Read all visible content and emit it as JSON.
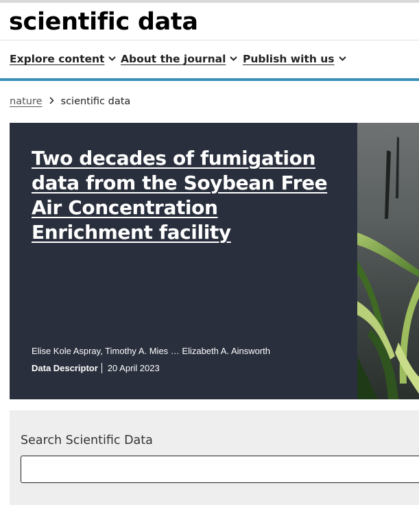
{
  "header": {
    "logo_light": "scientific",
    "logo_bold": "data"
  },
  "nav": {
    "items": [
      {
        "label": "Explore content",
        "icon": "chevron-down-icon"
      },
      {
        "label": "About the journal",
        "icon": "chevron-down-icon"
      },
      {
        "label": "Publish with us",
        "icon": "chevron-down-icon"
      }
    ]
  },
  "breadcrumb": {
    "items": [
      {
        "label": "nature"
      },
      {
        "label": "scientific data"
      }
    ],
    "separator_icon": "chevron-right-icon"
  },
  "hero": {
    "title": "Two decades of fumigation data from the Soybean Free Air Concentration Enrichment facility",
    "authors": "Elise Kole Aspray, Timothy A. Mies … Elizabeth A. Ainsworth",
    "article_type": "Data Descriptor",
    "date": "20 April 2023",
    "image_subject": "corn plants under stormy sky"
  },
  "search": {
    "label": "Search Scientific Data",
    "value": "",
    "placeholder": ""
  },
  "colors": {
    "accent": "#3a8fb7",
    "hero_panel": "#292f3c",
    "search_block": "#eeeeee"
  }
}
